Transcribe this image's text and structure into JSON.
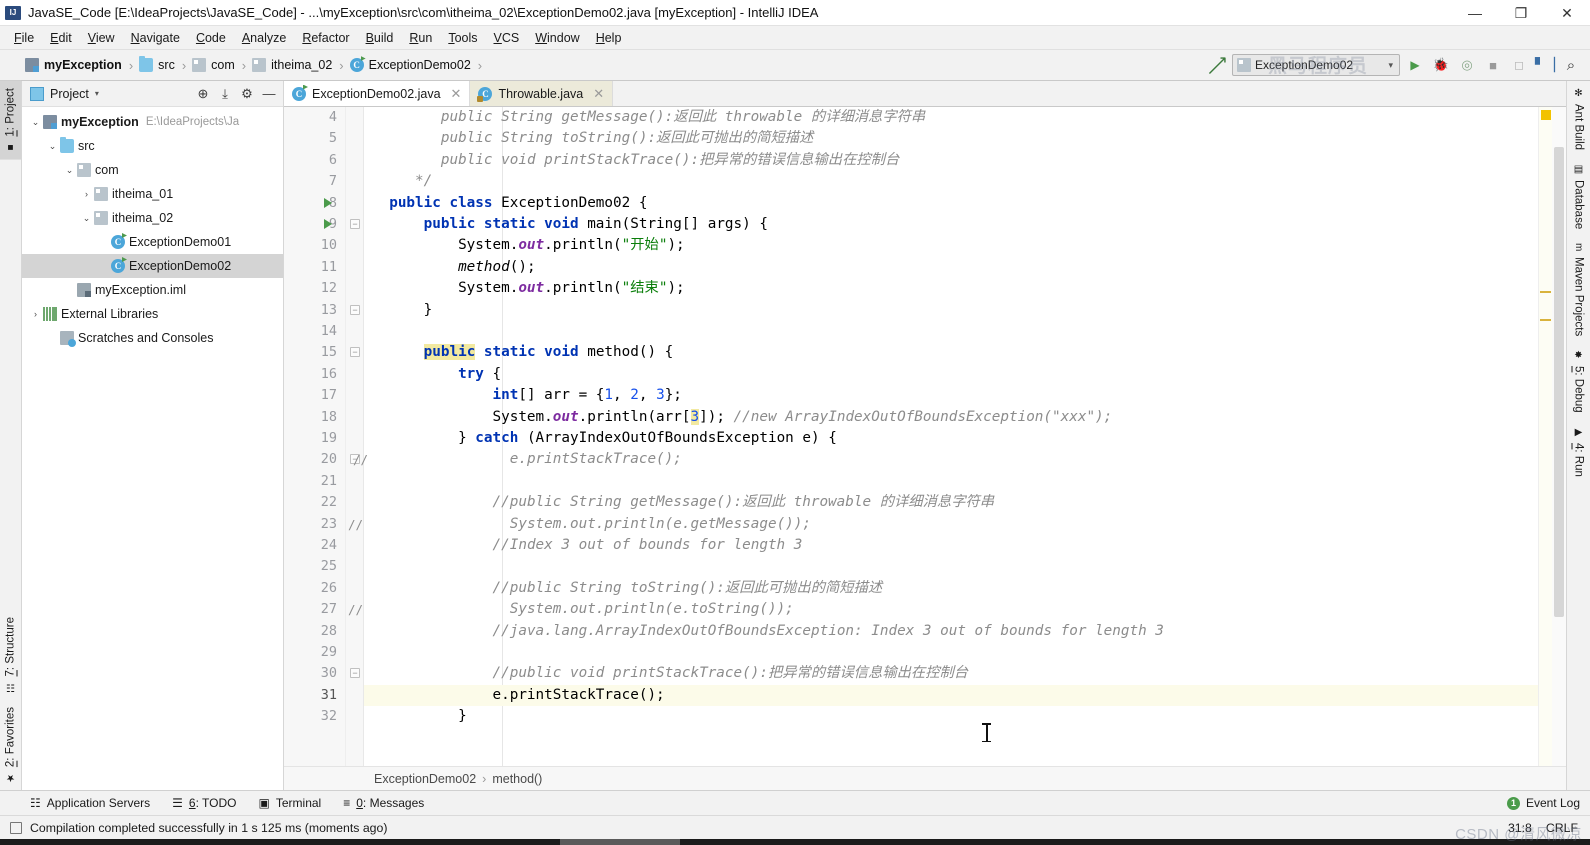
{
  "window": {
    "title": "JavaSE_Code [E:\\IdeaProjects\\JavaSE_Code] - ...\\myException\\src\\com\\itheima_02\\ExceptionDemo02.java [myException] - IntelliJ IDEA",
    "minimize": "—",
    "maximize": "❐",
    "close": "✕"
  },
  "menubar": {
    "items": [
      "File",
      "Edit",
      "View",
      "Navigate",
      "Code",
      "Analyze",
      "Refactor",
      "Build",
      "Run",
      "Tools",
      "VCS",
      "Window",
      "Help"
    ]
  },
  "breadcrumb": {
    "items": [
      {
        "label": "myException",
        "icon": "module-icon"
      },
      {
        "label": "src",
        "icon": "source-folder-icon"
      },
      {
        "label": "com",
        "icon": "package-icon"
      },
      {
        "label": "itheima_02",
        "icon": "package-icon"
      },
      {
        "label": "ExceptionDemo02",
        "icon": "java-class-icon"
      }
    ],
    "separator": "›"
  },
  "toolbar": {
    "back_arrow": "↖",
    "run_config": "ExceptionDemo02",
    "run_config_chevron": "▾",
    "run_label": "▶",
    "debug_label": "🐞",
    "search_label": "⌕",
    "watermark": "黑马程序员"
  },
  "left_strip": {
    "tabs": [
      {
        "label": "1: Project",
        "active": true,
        "icon": "project-icon"
      },
      {
        "label": "7: Structure",
        "active": false,
        "icon": "structure-icon"
      },
      {
        "label": "2: Favorites",
        "active": false,
        "icon": "star-icon"
      }
    ]
  },
  "right_strip": {
    "tabs": [
      {
        "label": "Ant Build",
        "icon": "ant-icon"
      },
      {
        "label": "Database",
        "icon": "database-icon"
      },
      {
        "label": "Maven Projects",
        "icon": "maven-icon"
      },
      {
        "label": "5: Debug",
        "icon": "bug-icon"
      },
      {
        "label": "4: Run",
        "icon": "run-icon"
      }
    ]
  },
  "project_panel": {
    "title": "Project",
    "chevron": "▾",
    "actions": [
      {
        "name": "locate-icon",
        "glyph": "⊕"
      },
      {
        "name": "collapse-all-icon",
        "glyph": "⤓"
      },
      {
        "name": "settings-gear-icon",
        "glyph": "⚙"
      },
      {
        "name": "hide-icon",
        "glyph": "—"
      }
    ],
    "tree": [
      {
        "label": "myException",
        "path": "E:\\IdeaProjects\\Ja",
        "indent": 0,
        "twisty": "⌄",
        "icon": "module-icon",
        "bold": true,
        "selected": false
      },
      {
        "label": "src",
        "path": "",
        "indent": 1,
        "twisty": "⌄",
        "icon": "source-folder-icon",
        "bold": false,
        "selected": false
      },
      {
        "label": "com",
        "path": "",
        "indent": 2,
        "twisty": "⌄",
        "icon": "package-icon",
        "bold": false,
        "selected": false
      },
      {
        "label": "itheima_01",
        "path": "",
        "indent": 3,
        "twisty": "›",
        "icon": "package-icon",
        "bold": false,
        "selected": false
      },
      {
        "label": "itheima_02",
        "path": "",
        "indent": 3,
        "twisty": "⌄",
        "icon": "package-icon",
        "bold": false,
        "selected": false
      },
      {
        "label": "ExceptionDemo01",
        "path": "",
        "indent": 4,
        "twisty": "",
        "icon": "java-class-icon",
        "bold": false,
        "selected": false
      },
      {
        "label": "ExceptionDemo02",
        "path": "",
        "indent": 4,
        "twisty": "",
        "icon": "java-class-icon",
        "bold": false,
        "selected": true
      },
      {
        "label": "myException.iml",
        "path": "",
        "indent": 2,
        "twisty": "",
        "icon": "iml-file-icon",
        "bold": false,
        "selected": false
      },
      {
        "label": "External Libraries",
        "path": "",
        "indent": 0,
        "twisty": "›",
        "icon": "library-icon",
        "bold": false,
        "selected": false
      },
      {
        "label": "Scratches and Consoles",
        "path": "",
        "indent": 1,
        "twisty": "",
        "icon": "scratches-icon",
        "bold": false,
        "selected": false
      }
    ]
  },
  "editor": {
    "tabs": [
      {
        "label": "ExceptionDemo02.java",
        "active": true,
        "icon": "java-class-icon",
        "close": "✕"
      },
      {
        "label": "Throwable.java",
        "active": false,
        "icon": "java-class-locked-icon",
        "close": "✕"
      }
    ],
    "first_line_number": 4,
    "lines": [
      {
        "n": 4,
        "html": "        <span class=\"cm\">public String getMessage():返回此 throwable 的详细消息字符串</span>"
      },
      {
        "n": 5,
        "html": "        <span class=\"cm\">public String toString():返回此可抛出的简短描述</span>"
      },
      {
        "n": 6,
        "html": "        <span class=\"cm\">public void printStackTrace():把异常的错误信息输出在控制台</span>"
      },
      {
        "n": 7,
        "html": "     <span class=\"cm\">*/</span>"
      },
      {
        "n": 8,
        "html": "  <span class=\"k\">public class</span> ExceptionDemo02 {"
      },
      {
        "n": 9,
        "html": "      <span class=\"k\">public static void</span> main(String[] args) {"
      },
      {
        "n": 10,
        "html": "          System.<span class=\"fld\">out</span>.println(<span class=\"st\">\"开始\"</span>);"
      },
      {
        "n": 11,
        "html": "          <span class=\"mth\">method</span>();"
      },
      {
        "n": 12,
        "html": "          System.<span class=\"fld\">out</span>.println(<span class=\"st\">\"结束\"</span>);"
      },
      {
        "n": 13,
        "html": "      }"
      },
      {
        "n": 14,
        "html": ""
      },
      {
        "n": 15,
        "html": "      <span class=\"k hl\">public</span> <span class=\"k\">static void</span> method() {"
      },
      {
        "n": 16,
        "html": "          <span class=\"k\">try</span> {"
      },
      {
        "n": 17,
        "html": "              <span class=\"k\">int</span>[] arr = {<span class=\"num\">1</span>, <span class=\"num\">2</span>, <span class=\"num\">3</span>};"
      },
      {
        "n": 18,
        "html": "              System.<span class=\"fld\">out</span>.println(arr[<span class=\"num hl\">3</span>]); <span class=\"cm\">//new ArrayIndexOutOfBoundsException(\"xxx\");</span>"
      },
      {
        "n": 19,
        "html": "          } <span class=\"k\">catch</span> (ArrayIndexOutOfBoundsException e) {"
      },
      {
        "n": 20,
        "html": "              <span class=\"cm\">  e.printStackTrace();</span>"
      },
      {
        "n": 21,
        "html": ""
      },
      {
        "n": 22,
        "html": "              <span class=\"cm\">//public String getMessage():返回此 throwable 的详细消息字符串</span>"
      },
      {
        "n": 23,
        "html": "               <span class=\"cm\"> System.out.println(e.getMessage());</span>"
      },
      {
        "n": 24,
        "html": "              <span class=\"cm\">//Index 3 out of bounds for length 3</span>"
      },
      {
        "n": 25,
        "html": ""
      },
      {
        "n": 26,
        "html": "              <span class=\"cm\">//public String toString():返回此可抛出的简短描述</span>"
      },
      {
        "n": 27,
        "html": "               <span class=\"cm\"> System.out.println(e.toString());</span>"
      },
      {
        "n": 28,
        "html": "              <span class=\"cm\">//java.lang.ArrayIndexOutOfBoundsException: Index 3 out of bounds for length 3</span>"
      },
      {
        "n": 29,
        "html": ""
      },
      {
        "n": 30,
        "html": "              <span class=\"cm\">//public void printStackTrace():把异常的错误信息输出在控制台</span>"
      },
      {
        "n": 31,
        "html": "              e.printStackTrace();",
        "current": true
      },
      {
        "n": 32,
        "html": "          }"
      }
    ],
    "run_arrow_lines": [
      8,
      9
    ],
    "fold_lines": [
      9,
      13,
      15,
      20,
      30
    ],
    "comment_gutter_lines": [
      20,
      23,
      27
    ],
    "breadcrumb": [
      "ExceptionDemo02",
      "method()"
    ],
    "breadcrumb_separator": "›"
  },
  "bottom_bar": {
    "tools": [
      {
        "label": "Application Servers",
        "icon": "app-servers-icon"
      },
      {
        "label": "6: TODO",
        "icon": "todo-icon"
      },
      {
        "label": "Terminal",
        "icon": "terminal-icon"
      },
      {
        "label": "0: Messages",
        "icon": "messages-icon"
      }
    ],
    "event_log": "Event Log",
    "event_log_count": "1"
  },
  "status_bar": {
    "message": "Compilation completed successfully in 1 s 125 ms (moments ago)",
    "position": "31:8",
    "line_separator": "CRLF",
    "watermark": "CSDN @清风微凉"
  },
  "colors": {
    "accent_green": "#4b9b4b",
    "keyword_blue": "#0033b3",
    "string_green": "#0a7e0a",
    "comment_gray": "#8c8c8c",
    "highlight_yellow": "#f2e9a0",
    "current_line": "#fcfbe9",
    "selection_gray": "#d4d4d4"
  }
}
